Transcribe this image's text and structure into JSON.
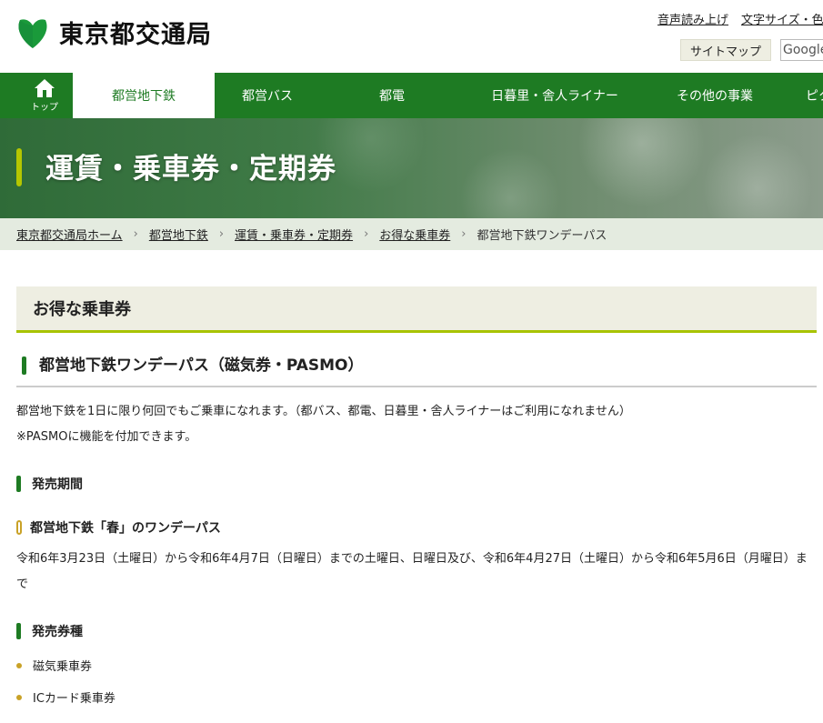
{
  "header": {
    "logo_text": "東京都交通局",
    "util_links": [
      "音声読み上げ",
      "文字サイズ・色"
    ],
    "sitemap_label": "サイトマップ",
    "search_placeholder": "Google"
  },
  "nav": {
    "home_label": "トップ",
    "items": [
      "都営地下鉄",
      "都営バス",
      "都電",
      "日暮里・舎人ライナー",
      "その他の事業",
      "ピク"
    ]
  },
  "hero": {
    "title": "運賃・乗車券・定期券"
  },
  "breadcrumb": {
    "items": [
      "東京都交通局ホーム",
      "都営地下鉄",
      "運賃・乗車券・定期券",
      "お得な乗車券"
    ],
    "current": "都営地下鉄ワンデーパス"
  },
  "content": {
    "section_title": "お得な乗車券",
    "product_title": "都営地下鉄ワンデーパス（磁気券・PASMO）",
    "intro": [
      "都営地下鉄を1日に限り何回でもご乗車になれます。（都バス、都電、日暮里・舎人ライナーはご利用になれません）",
      "※PASMOに機能を付加できます。"
    ],
    "period_heading": "発売期間",
    "spring_heading": "都営地下鉄「春」のワンデーパス",
    "spring_period": "令和6年3月23日（土曜日）から令和6年4月7日（日曜日）までの土曜日、日曜日及び、令和6年4月27日（土曜日）から令和6年5月6日（月曜日）まで",
    "types_heading": "発売券種",
    "types": [
      "磁気乗車券",
      "ICカード乗車券"
    ]
  },
  "colors": {
    "brand_green": "#1e7b23",
    "accent_lime": "#a8c300",
    "accent_gold": "#c9a227"
  }
}
